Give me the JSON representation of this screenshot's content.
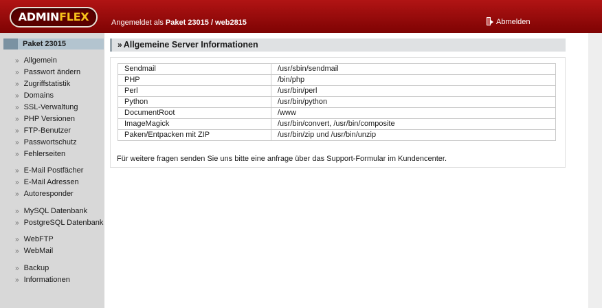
{
  "header": {
    "logo_part1": "ADMIN",
    "logo_part2": "FLEX",
    "login_prefix": "Angemeldet als",
    "login_user": "Paket 23015 / web2815",
    "logout_label": "Abmelden"
  },
  "sidebar": {
    "heading": "Paket 23015",
    "items": [
      {
        "label": "Allgemein"
      },
      {
        "label": "Passwort ändern"
      },
      {
        "label": "Zugriffstatistik"
      },
      {
        "label": "Domains"
      },
      {
        "label": "SSL-Verwaltung"
      },
      {
        "label": "PHP Versionen"
      },
      {
        "label": "FTP-Benutzer"
      },
      {
        "label": "Passwortschutz"
      },
      {
        "label": "Fehlerseiten"
      },
      {
        "label": "E-Mail Postfächer"
      },
      {
        "label": "E-Mail Adressen"
      },
      {
        "label": "Autoresponder"
      },
      {
        "label": "MySQL Datenbank"
      },
      {
        "label": "PostgreSQL Datenbank"
      },
      {
        "label": "WebFTP"
      },
      {
        "label": "WebMail"
      },
      {
        "label": "Backup"
      },
      {
        "label": "Informationen"
      }
    ]
  },
  "main": {
    "title": "Allgemeine Server Informationen",
    "rows": [
      {
        "key": "Sendmail",
        "value": "/usr/sbin/sendmail"
      },
      {
        "key": "PHP",
        "value": "/bin/php"
      },
      {
        "key": "Perl",
        "value": "/usr/bin/perl"
      },
      {
        "key": "Python",
        "value": "/usr/bin/python"
      },
      {
        "key": "DocumentRoot",
        "value": "/www"
      },
      {
        "key": "ImageMagick",
        "value": "/usr/bin/convert, /usr/bin/composite"
      },
      {
        "key": "Paken/Entpacken mit ZIP",
        "value": "/usr/bin/zip und /usr/bin/unzip"
      }
    ],
    "footnote": "Für weitere fragen senden Sie uns bitte eine anfrage über das Support-Formular im Kundencenter."
  },
  "colors": {
    "header_red": "#9c0a0a",
    "logo_yellow": "#f6c21b",
    "sidebar_bg": "#d8d8d8",
    "sidebar_heading_bg": "#b3c4cf"
  }
}
